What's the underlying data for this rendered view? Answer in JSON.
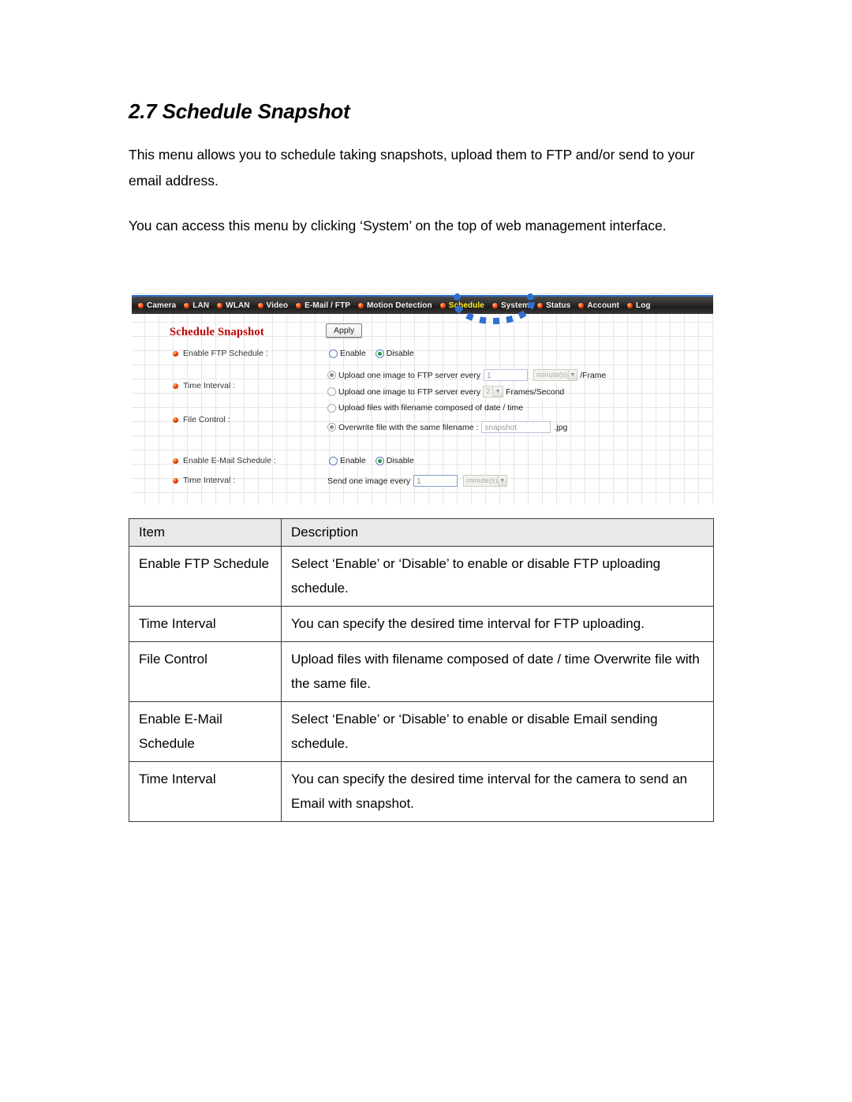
{
  "document": {
    "heading": "2.7 Schedule Snapshot",
    "paragraph_1": "This menu allows you to schedule taking snapshots, upload them to FTP and/or send to your email address.",
    "paragraph_2": "You can access this menu by clicking ‘System’ on the top of web management interface."
  },
  "screenshot": {
    "nav": {
      "items": [
        {
          "label": "Camera",
          "active": false
        },
        {
          "label": "LAN",
          "active": false
        },
        {
          "label": "WLAN",
          "active": false
        },
        {
          "label": "Video",
          "active": false
        },
        {
          "label": "E-Mail / FTP",
          "active": false
        },
        {
          "label": "Motion Detection",
          "active": false
        },
        {
          "label": "Schedule",
          "active": true
        },
        {
          "label": "System",
          "active": false
        },
        {
          "label": "Status",
          "active": false
        },
        {
          "label": "Account",
          "active": false
        },
        {
          "label": "Log",
          "active": false
        }
      ],
      "active_color": "#ffef24",
      "bullet_color": "#ff4d10",
      "bar_color": "#2e2d2b",
      "annotation_color": "#2f6fd0"
    },
    "panel": {
      "title": "Schedule Snapshot",
      "apply_label": "Apply",
      "fields": {
        "enable_ftp_schedule": "Enable FTP Schedule :",
        "time_interval_ftp": "Time Interval :",
        "file_control": "File Control :",
        "enable_email_schedule": "Enable E-Mail Schedule :",
        "time_interval_email": "Time Interval :"
      },
      "ftp_schedule": {
        "enable_label": "Enable",
        "disable_label": "Disable",
        "selected": "Disable"
      },
      "ftp_time_interval": {
        "option_1_label": "Upload one image to FTP server every",
        "option_1_value": "1",
        "option_1_unit": "minute(s)",
        "option_1_suffix": "/Frame",
        "option_1_selected": true,
        "option_2_label": "Upload one image to FTP server every",
        "option_2_value": "2",
        "option_2_suffix": "Frames/Second",
        "option_2_selected": false
      },
      "file_control": {
        "option_1_label": "Upload files with filename composed of date / time",
        "option_1_selected": false,
        "option_2_label": "Overwrite file with the same filename :",
        "option_2_value": "snapshot",
        "option_2_suffix": ".jpg",
        "option_2_selected": true
      },
      "email_schedule": {
        "enable_label": "Enable",
        "disable_label": "Disable",
        "selected": "Disable"
      },
      "email_time_interval": {
        "prefix_label": "Send one image every",
        "value": "1",
        "unit": "minute(s)"
      }
    }
  },
  "table": {
    "headers": {
      "item": "Item",
      "description": "Description"
    },
    "rows": [
      {
        "item": "Enable FTP Schedule",
        "description": "Select ‘Enable’ or ‘Disable’ to enable or disable FTP uploading schedule."
      },
      {
        "item": "Time Interval",
        "description": "You can specify the desired time interval for FTP uploading."
      },
      {
        "item": "File Control",
        "description": "Upload files with filename composed of date / time Overwrite file with the same file."
      },
      {
        "item": "Enable E-Mail Schedule",
        "description": "Select ‘Enable’ or ‘Disable’ to enable or disable Email sending schedule."
      },
      {
        "item": "Time Interval",
        "description": "You can specify the desired time interval for the camera to send an Email with snapshot."
      }
    ]
  }
}
